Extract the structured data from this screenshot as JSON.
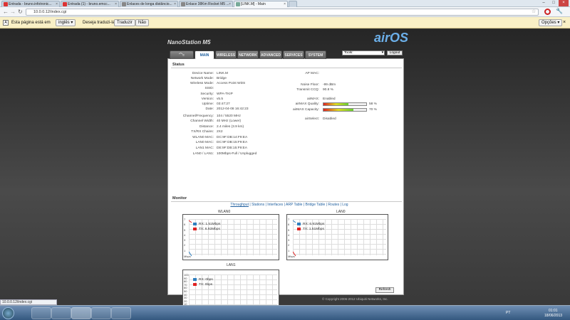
{
  "browser": {
    "tabs": [
      {
        "label": "Entrada - bruno.infotronic...",
        "fav": "gmail-icon"
      },
      {
        "label": "Entrada (1) - bruno.emcc...",
        "fav": "gmail-icon"
      },
      {
        "label": "Enlaces de longa distâncio...",
        "fav": "page-icon"
      },
      {
        "label": "Enlace 38Km Rocket M5 ...",
        "fav": "page-icon"
      },
      {
        "label": "[LINK.M] - Main",
        "fav": "page-icon"
      }
    ],
    "url": "10.0.0.12/index.cgi",
    "translate": {
      "text1": "Esta página está em",
      "language": "inglês",
      "text2": "Deseja traduzi-la?",
      "translate_btn": "Traduzir",
      "no_btn": "Não",
      "options_btn": "Opções"
    }
  },
  "device": {
    "model": "NanoStation M5",
    "brand": "airOS",
    "tabs": [
      "MAIN",
      "WIRELESS",
      "NETWORK",
      "ADVANCED",
      "SERVICES",
      "SYSTEM"
    ],
    "tools_select": "Tools:",
    "logout": "Logout"
  },
  "status": {
    "title": "Status",
    "left": [
      {
        "label": "Device Name:",
        "value": "LINK.M"
      },
      {
        "label": "Network Mode:",
        "value": "Bridge"
      },
      {
        "label": "Wireless Mode:",
        "value": "Access Point WDS"
      },
      {
        "label": "SSID:",
        "value": ""
      },
      {
        "label": "Security:",
        "value": "WPA-TKIP"
      },
      {
        "label": "Version:",
        "value": "v5.5"
      },
      {
        "label": "Uptime:",
        "value": "03:47:27"
      },
      {
        "label": "Date:",
        "value": "2012-04-08 16:42:23"
      },
      {
        "label": "Channel/Frequency:",
        "value": "104 / 5520 MHz"
      },
      {
        "label": "Channel Width:",
        "value": "40 MHz (Lower)"
      },
      {
        "label": "Distance:",
        "value": "2.4 miles (3.9 km)"
      },
      {
        "label": "TX/RX Chains:",
        "value": "2X2"
      },
      {
        "label": "WLAN0 MAC:",
        "value": "DC:9F:DB:14:F9:EA"
      },
      {
        "label": "LAN0 MAC:",
        "value": "DC:9F:DB:15:F9:EA"
      },
      {
        "label": "LAN1 MAC:",
        "value": "DE:9F:DB:15:F9:EA"
      },
      {
        "label": "LAN0 / LAN1:",
        "value": "100Mbps-Full / Unplugged"
      }
    ],
    "right": [
      {
        "label": "AP MAC:",
        "value": ""
      },
      {
        "label": "Noise Floor:",
        "value": "-99 dBm"
      },
      {
        "label": "Transmit CCQ:",
        "value": "90.8 %"
      },
      {
        "label": "airMAX:",
        "value": "Enabled"
      },
      {
        "label": "airMAX Quality:",
        "value": "58 %"
      },
      {
        "label": "airMAX Capacity:",
        "value": "70 %"
      },
      {
        "label": "airSelect:",
        "value": "Disabled"
      }
    ],
    "quality_pct": 58,
    "capacity_pct": 70
  },
  "monitor": {
    "title": "Monitor",
    "links": [
      "Throughput",
      "Stations",
      "Interfaces",
      "ARP Table",
      "Bridge Table",
      "Routes",
      "Log"
    ],
    "charts": [
      {
        "title": "WLAN0",
        "rx": "RX: 1.51Mbps",
        "tx": "TX: 6.92Mbps",
        "ymax": 7,
        "unit": "Mbps"
      },
      {
        "title": "LAN0",
        "rx": "RX: 6.91Mbps",
        "tx": "TX: 1.51Mbps",
        "ymax": 7,
        "unit": "Mbps"
      },
      {
        "title": "LAN1",
        "rx": "RX: 0bps",
        "tx": "TX: 0bps",
        "ymax": 100,
        "unit": "bps"
      }
    ],
    "refresh": "Refresh"
  },
  "footer": "© Copyright 2006-2012 Ubiquiti Networks, Inc.",
  "status_url": "10.0.0.12/index.cgi",
  "taskbar": {
    "lang": "PT",
    "time": "01:01",
    "date": "18/06/2013"
  },
  "colors": {
    "rx": "#2f7fbf",
    "tx": "#e02020",
    "accent": "#1f5f9f"
  }
}
